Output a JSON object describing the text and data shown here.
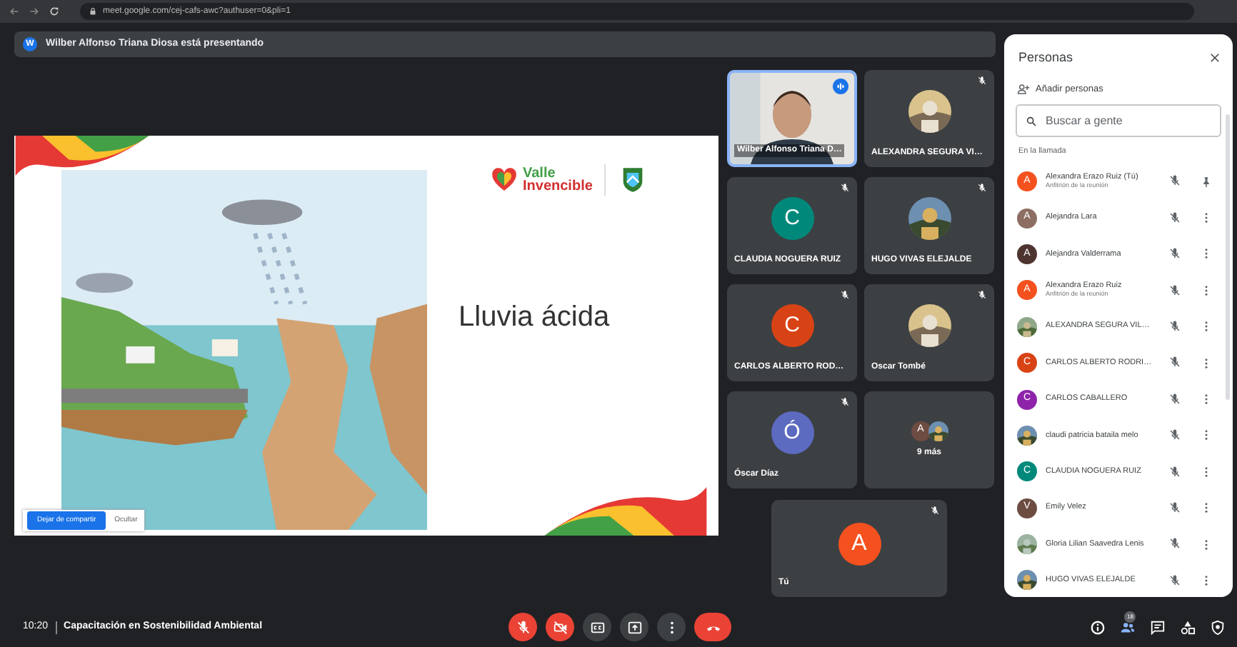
{
  "browser": {
    "url": "meet.google.com/cej-cafs-awc?authuser=0&pli=1"
  },
  "presenting_banner": {
    "avatar_letter": "W",
    "text": "Wilber Alfonso Triana Diosa está presentando"
  },
  "slide": {
    "title": "Lluvia ácida",
    "logo_lines": [
      "Valle",
      "Invencible"
    ],
    "share_bar": [
      {
        "label": "Dejar de compartir",
        "kind": "primary"
      },
      {
        "label": "Ocultar",
        "kind": "plain"
      }
    ]
  },
  "tiles": [
    {
      "name": "Wilber Alfonso Triana D…",
      "kind": "video",
      "speaking": true,
      "muted": false
    },
    {
      "name": "ALEXANDRA SEGURA VI…",
      "muted": true
    },
    {
      "name": "CLAUDIA NOGUERA RUIZ",
      "kind": "letter",
      "letter": "C",
      "color": "#00897b",
      "muted": true
    },
    {
      "name": "HUGO VIVAS ELEJALDE",
      "muted": true
    },
    {
      "name": "CARLOS ALBERTO ROD…",
      "kind": "letter",
      "letter": "C",
      "color": "#d84315",
      "muted": true
    },
    {
      "name": "Oscar Tombé",
      "muted": true
    },
    {
      "name": "Óscar Díaz",
      "kind": "letter",
      "letter": "Ó",
      "color": "#5c6bc0",
      "muted": true
    },
    {
      "name": "9 más",
      "kind": "more",
      "letter": "A",
      "color": "#6d4c41"
    }
  ],
  "self_tile": {
    "name": "Tú",
    "letter": "A",
    "color": "#f4511e",
    "muted": true
  },
  "people_panel": {
    "title": "Personas",
    "add_label": "Añadir personas",
    "search": {
      "placeholder": "Buscar a gente"
    },
    "section": "En la llamada",
    "people": [
      {
        "name": "Alexandra Erazo Ruiz (Tú)",
        "subtitle": "Anfitrión de la reunión",
        "avatar": {
          "kind": "letter",
          "letter": "A",
          "color": "#f4511e"
        },
        "muted": true,
        "action": {
          "kind": "pin"
        }
      },
      {
        "name": "Alejandra Lara",
        "avatar": {
          "kind": "letter",
          "letter": "A",
          "color": "#8d6e63"
        },
        "muted": true,
        "action": {
          "kind": "more"
        }
      },
      {
        "name": "Alejandra Valderrama",
        "avatar": {
          "kind": "letter",
          "letter": "A",
          "color": "#4e342e"
        },
        "muted": true,
        "action": {
          "kind": "more"
        }
      },
      {
        "name": "Alexandra Erazo Ruiz",
        "subtitle": "Anfitrión de la reunión",
        "avatar": {
          "kind": "letter",
          "letter": "A",
          "color": "#f4511e"
        },
        "muted": true,
        "action": {
          "kind": "more"
        }
      },
      {
        "name": "ALEXANDRA SEGURA VIL…",
        "muted": true,
        "action": {
          "kind": "more"
        }
      },
      {
        "name": "CARLOS ALBERTO RODRI…",
        "avatar": {
          "kind": "letter",
          "letter": "C",
          "color": "#d84315"
        },
        "muted": true,
        "action": {
          "kind": "more"
        }
      },
      {
        "name": "CARLOS CABALLERO",
        "avatar": {
          "kind": "letter",
          "letter": "C",
          "color": "#8e24aa"
        },
        "muted": true,
        "action": {
          "kind": "more"
        }
      },
      {
        "name": "claudi patricia bataila melo",
        "muted": true,
        "action": {
          "kind": "more"
        }
      },
      {
        "name": "CLAUDIA NOGUERA RUIZ",
        "avatar": {
          "kind": "letter",
          "letter": "C",
          "color": "#00897b"
        },
        "muted": true,
        "action": {
          "kind": "more"
        }
      },
      {
        "name": "Emily Velez",
        "avatar": {
          "kind": "letter",
          "letter": "V",
          "color": "#6d4c41"
        },
        "muted": true,
        "action": {
          "kind": "more"
        }
      },
      {
        "name": "Gloria Lilian Saavedra Lenis",
        "muted": true,
        "action": {
          "kind": "more"
        }
      },
      {
        "name": "HUGO VIVAS ELEJALDE",
        "muted": true,
        "action": {
          "kind": "more"
        }
      }
    ]
  },
  "bottom_bar": {
    "time": "10:20",
    "meeting_title": "Capacitación en Sostenibilidad Ambiental",
    "controls": [
      {
        "kind": "mic",
        "on": false
      },
      {
        "kind": "camera",
        "on": false
      },
      {
        "kind": "captions"
      },
      {
        "kind": "present"
      },
      {
        "kind": "more"
      },
      {
        "kind": "leave"
      }
    ],
    "side_buttons": [
      {
        "kind": "info",
        "selected": false
      },
      {
        "kind": "people",
        "badge": "18",
        "selected": true
      },
      {
        "kind": "chat",
        "selected": false
      },
      {
        "kind": "activities",
        "selected": false
      },
      {
        "kind": "safety",
        "selected": false
      }
    ]
  }
}
